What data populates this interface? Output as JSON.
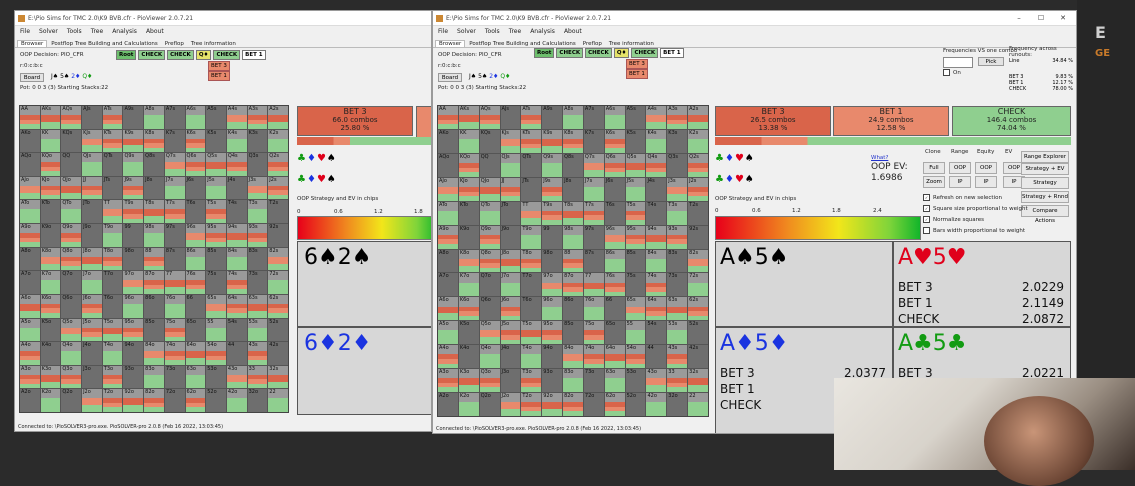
{
  "left_window": {
    "title": "E:\\Pio Sims for TMC 2.0\\K9 BVB.cfr - PioViewer 2.0.7.21",
    "menu": [
      "File",
      "Solver",
      "Tools",
      "Tree",
      "Analysis",
      "About"
    ],
    "tabs": [
      "Browser",
      "Postflop Tree Building and Calculations",
      "Preflop",
      "Tree information"
    ],
    "decision": "OOP Decision:  PIO_CFR",
    "line": "r:0:c:b:c",
    "board_btn": "Board",
    "board_cards": [
      "J♠",
      "5♠",
      "2♦",
      "Q♦"
    ],
    "pot": "Pot: 0 0 3 (3) Starting Stacks:22",
    "crumbs": [
      "Root",
      "CHECK",
      "CHECK",
      "Q♦",
      "CHECK",
      "BET 1"
    ],
    "sub_actions": [
      "BET 3",
      "BET 1"
    ],
    "action_bars": [
      {
        "label": "BET 3",
        "combos": "66.0 combos",
        "pct": "25.80 %"
      }
    ],
    "strategy_label": "OOP Strategy and EV in chips",
    "scale": [
      "0",
      "0.6",
      "1.2",
      "1.8"
    ],
    "cards": [
      "6♠2♠",
      "6♦2♦"
    ],
    "status": "Connected to: \\PioSOLVER3-pro.exe. PioSOLVER-pro 2.0.8 (Feb 16 2022, 13:03:45)"
  },
  "right_window": {
    "title": "E:\\Pio Sims for TMC 2.0\\K9 BVB.cfr - PioViewer 2.0.7.21",
    "menu": [
      "File",
      "Solver",
      "Tools",
      "Tree",
      "Analysis",
      "About"
    ],
    "tabs": [
      "Browser",
      "Postflop Tree Building and Calculations",
      "Preflop",
      "Tree information"
    ],
    "decision": "OOP Decision:  PIO_CFR",
    "line": "r:0:c:b:c",
    "board_btn": "Board",
    "board_cards": [
      "J♠",
      "5♠",
      "2♦",
      "Q♦"
    ],
    "pot": "Pot: 0 0 3 (3) Starting Stacks:22",
    "crumbs": [
      "Root",
      "CHECK",
      "CHECK",
      "Q♦",
      "CHECK",
      "BET 1"
    ],
    "sub_actions": [
      "BET 3",
      "BET 1"
    ],
    "freq_title": "Frequencies VS one combo",
    "pick_btn": "Pick",
    "on_label": "On",
    "runouts_title": "Frequency across runouts:",
    "runouts": [
      {
        "name": "Line",
        "value": "34.84 %"
      },
      {
        "name": "BET 3",
        "value": "9.83 %"
      },
      {
        "name": "BET 1",
        "value": "12.17 %"
      },
      {
        "name": "CHECK",
        "value": "78.00 %"
      }
    ],
    "action_bars": [
      {
        "label": "BET 3",
        "combos": "26.5 combos",
        "pct": "13.38 %"
      },
      {
        "label": "BET 1",
        "combos": "24.9 combos",
        "pct": "12.58 %"
      },
      {
        "label": "CHECK",
        "combos": "146.4 combos",
        "pct": "74.04 %"
      }
    ],
    "what_link": "What?",
    "oop_ev_label": "OOP EV:",
    "oop_ev": "1.6986",
    "ctrl_headers": [
      "Clone",
      "Range",
      "Equity",
      "EV"
    ],
    "ctrl_row1": [
      "Full",
      "OOP",
      "OOP",
      "OOP"
    ],
    "ctrl_row2": [
      "Zoom",
      "IP",
      "IP",
      "IP"
    ],
    "side_buttons": [
      "Range Explorer",
      "Strategy + EV",
      "Strategy",
      "Strategy + Rnnd",
      "Compare Actions"
    ],
    "checks": [
      {
        "label": "Refresh on new selection",
        "checked": true
      },
      {
        "label": "Square size proportional to weight",
        "checked": true
      },
      {
        "label": "Normalize squares",
        "checked": true
      },
      {
        "label": "Bars width proportional to weight",
        "checked": false
      }
    ],
    "strategy_label": "OOP Strategy and EV in chips",
    "scale": [
      "0",
      "0.6",
      "1.2",
      "1.8",
      "2.4"
    ],
    "combo_panels": [
      {
        "cards": "A♠5♠",
        "color": "black",
        "rows": []
      },
      {
        "cards": "A♥5♥",
        "color": "red",
        "rows": [
          {
            "a": "BET 3",
            "v": "2.0229"
          },
          {
            "a": "BET 1",
            "v": "2.1149"
          },
          {
            "a": "CHECK",
            "v": "2.0872"
          }
        ]
      },
      {
        "cards": "A♦5♦",
        "color": "blue",
        "rows": [
          {
            "a": "BET 3",
            "v": "2.0377"
          },
          {
            "a": "BET 1",
            "v": ""
          },
          {
            "a": "CHECK",
            "v": ""
          }
        ]
      },
      {
        "cards": "A♣5♣",
        "color": "green",
        "rows": [
          {
            "a": "BET 3",
            "v": "2.0221"
          }
        ]
      }
    ],
    "status": "Connected to: \\PioSOLVER3-pro.exe. PioSOLVER-pro 2.0.8 (Feb 16 2022, 13:03:45)"
  },
  "ranks": [
    "A",
    "K",
    "Q",
    "J",
    "T",
    "9",
    "8",
    "7",
    "6",
    "5",
    "4",
    "3",
    "2"
  ],
  "colors": {
    "bet3": "#d9644a",
    "bet1": "#e8896c",
    "check": "#8fcf8f",
    "cell_bg": "#6e6e6e"
  }
}
